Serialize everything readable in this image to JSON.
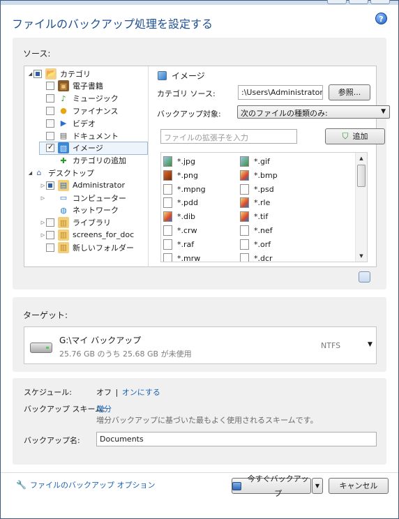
{
  "window": {
    "title": "ファイルのバックアップ処理を設定する"
  },
  "source": {
    "heading": "ソース:",
    "tree": [
      {
        "label": "カテゴリ",
        "icon": "category-icon",
        "check": "partial",
        "expand": "open",
        "indent": 0
      },
      {
        "label": "電子書籍",
        "icon": "ebook-icon",
        "check": "off",
        "expand": "none",
        "indent": 1
      },
      {
        "label": "ミュージック",
        "icon": "music-icon",
        "check": "off",
        "expand": "none",
        "indent": 1
      },
      {
        "label": "ファイナンス",
        "icon": "finance-icon",
        "check": "off",
        "expand": "none",
        "indent": 1
      },
      {
        "label": "ビデオ",
        "icon": "video-icon",
        "check": "off",
        "expand": "none",
        "indent": 1
      },
      {
        "label": "ドキュメント",
        "icon": "document-icon",
        "check": "off",
        "expand": "none",
        "indent": 1
      },
      {
        "label": "イメージ",
        "icon": "image-icon",
        "check": "on",
        "expand": "none",
        "indent": 1
      },
      {
        "label": "カテゴリの追加",
        "icon": "add-category-icon",
        "check": "none",
        "expand": "none",
        "indent": 1
      },
      {
        "label": "デスクトップ",
        "icon": "desktop-icon",
        "check": "none",
        "expand": "open",
        "indent": 0
      },
      {
        "label": "Administrator",
        "icon": "user-folder-icon",
        "check": "partial",
        "expand": "closed",
        "indent": 1
      },
      {
        "label": "コンピューター",
        "icon": "computer-icon",
        "check": "none",
        "expand": "closed",
        "indent": 1
      },
      {
        "label": "ネットワーク",
        "icon": "network-icon",
        "check": "none",
        "expand": "none",
        "indent": 1
      },
      {
        "label": "ライブラリ",
        "icon": "library-icon",
        "check": "off",
        "expand": "closed",
        "indent": 1
      },
      {
        "label": "screens_for_doc",
        "icon": "locked-folder-icon",
        "check": "off",
        "expand": "closed",
        "indent": 1
      },
      {
        "label": "新しいフォルダー",
        "icon": "locked-folder-icon",
        "check": "off",
        "expand": "none",
        "indent": 1
      }
    ],
    "detail": {
      "title": "イメージ",
      "category_source_label": "カテゴリ ソース:",
      "category_source_value": ":\\Users\\Administrator",
      "browse_label": "参照...",
      "backup_target_label": "バックアップ対象:",
      "backup_target_value": "次のファイルの種類のみ:",
      "extension_placeholder": "ファイルの拡張子を入力",
      "add_label": "追加",
      "extensions_left": [
        {
          "ext": "*.jpg",
          "icon": "img"
        },
        {
          "ext": "*.png",
          "icon": "red"
        },
        {
          "ext": "*.mpng",
          "icon": "blank"
        },
        {
          "ext": "*.pdd",
          "icon": "blank"
        },
        {
          "ext": "*.dib",
          "icon": "multi"
        },
        {
          "ext": "*.crw",
          "icon": "blank"
        },
        {
          "ext": "*.raf",
          "icon": "blank"
        },
        {
          "ext": "*.mrw",
          "icon": "blank"
        }
      ],
      "extensions_right": [
        {
          "ext": "*.gif",
          "icon": "img"
        },
        {
          "ext": "*.bmp",
          "icon": "multi"
        },
        {
          "ext": "*.psd",
          "icon": "blank"
        },
        {
          "ext": "*.rle",
          "icon": "multi"
        },
        {
          "ext": "*.tif",
          "icon": "multi"
        },
        {
          "ext": "*.nef",
          "icon": "blank"
        },
        {
          "ext": "*.orf",
          "icon": "blank"
        },
        {
          "ext": "*.dcr",
          "icon": "blank"
        }
      ]
    }
  },
  "target": {
    "heading": "ターゲット:",
    "name": "G:\\マイ バックアップ",
    "usage": "25.76 GB のうち 25.68 GB が未使用",
    "filesystem": "NTFS"
  },
  "settings": {
    "schedule_label": "スケジュール:",
    "schedule_value": "オフ",
    "schedule_separator": "|",
    "schedule_link": "オンにする",
    "scheme_label": "バックアップ スキーム:",
    "scheme_value": "増分",
    "scheme_description": "増分バックアップに基づいた最もよく使用されるスキームです。",
    "name_label": "バックアップ名:",
    "name_value": "Documents"
  },
  "footer": {
    "options_link": "ファイルのバックアップ オプション",
    "backup_now_label": "今すぐバックアップ",
    "cancel_label": "キャンセル"
  },
  "colors": {
    "title": "#1c4f92",
    "link": "#1a63b5",
    "panel": "#f0f0f0"
  }
}
